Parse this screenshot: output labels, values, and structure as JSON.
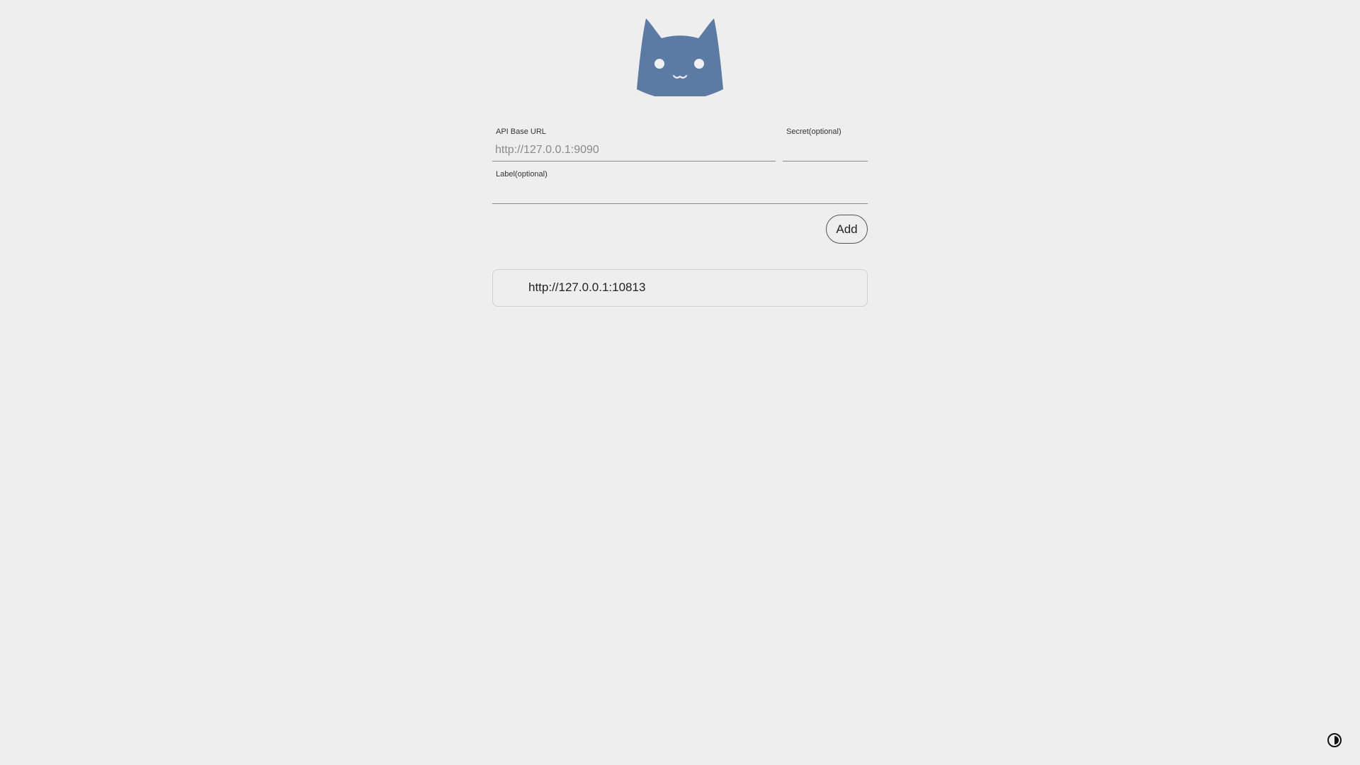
{
  "app": {
    "logo_icon": "cat-head-icon",
    "brand_color": "#5b7aa4"
  },
  "form": {
    "api_base_url": {
      "label": "API Base URL",
      "value": "",
      "placeholder": "http://127.0.0.1:9090"
    },
    "secret": {
      "label": "Secret(optional)",
      "value": "",
      "placeholder": ""
    },
    "label_field": {
      "label": "Label(optional)",
      "value": "",
      "placeholder": ""
    },
    "add_label": "Add"
  },
  "backends": [
    {
      "url": "http://127.0.0.1:10813"
    }
  ],
  "theme_toggle_icon": "contrast-icon"
}
